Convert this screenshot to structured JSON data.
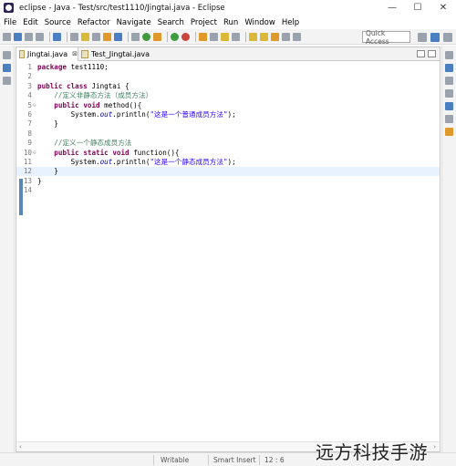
{
  "window": {
    "title": "eclipse - Java - Test/src/test1110/Jingtai.java - Eclipse",
    "controls": {
      "minimize": "—",
      "maximize": "☐",
      "close": "✕"
    }
  },
  "menu": [
    "File",
    "Edit",
    "Source",
    "Refactor",
    "Navigate",
    "Search",
    "Project",
    "Run",
    "Window",
    "Help"
  ],
  "toolbar": {
    "quick_access_placeholder": "Quick Access"
  },
  "tabs": [
    {
      "label": "Jingtai.java",
      "close": "⊠",
      "active": true
    },
    {
      "label": "Test_Jingtai.java",
      "active": false
    }
  ],
  "code": {
    "lines": [
      {
        "num": "1",
        "fold": "",
        "tokens": [
          [
            "kw",
            "package"
          ],
          [
            "",
            " test1110;"
          ]
        ]
      },
      {
        "num": "2",
        "fold": "",
        "tokens": []
      },
      {
        "num": "3",
        "fold": "",
        "tokens": [
          [
            "kw",
            "public"
          ],
          [
            "",
            " "
          ],
          [
            "kw",
            "class"
          ],
          [
            "",
            " Jingtai {"
          ]
        ]
      },
      {
        "num": "4",
        "fold": "",
        "tokens": [
          [
            "",
            "    "
          ],
          [
            "cm",
            "//定义非静态方法（成员方法）"
          ]
        ]
      },
      {
        "num": "5",
        "fold": "⊖",
        "tokens": [
          [
            "",
            "    "
          ],
          [
            "kw",
            "public"
          ],
          [
            "",
            " "
          ],
          [
            "kw",
            "void"
          ],
          [
            "",
            " method(){"
          ]
        ]
      },
      {
        "num": "6",
        "fold": "",
        "tokens": [
          [
            "",
            "        System."
          ],
          [
            "fld",
            "out"
          ],
          [
            "",
            ".println("
          ],
          [
            "str",
            "\"这是一个普通成员方法\""
          ],
          [
            "",
            ");"
          ]
        ]
      },
      {
        "num": "7",
        "fold": "",
        "tokens": [
          [
            "",
            "    }"
          ]
        ]
      },
      {
        "num": "8",
        "fold": "",
        "tokens": []
      },
      {
        "num": "9",
        "fold": "",
        "tokens": [
          [
            "",
            "    "
          ],
          [
            "cm",
            "//定义一个静态成员方法"
          ]
        ]
      },
      {
        "num": "10",
        "fold": "⊖",
        "tokens": [
          [
            "",
            "    "
          ],
          [
            "kw",
            "public"
          ],
          [
            "",
            " "
          ],
          [
            "kw",
            "static"
          ],
          [
            "",
            " "
          ],
          [
            "kw",
            "void"
          ],
          [
            "",
            " function(){"
          ]
        ]
      },
      {
        "num": "11",
        "fold": "",
        "tokens": [
          [
            "",
            "        System."
          ],
          [
            "fld",
            "out"
          ],
          [
            "",
            ".println("
          ],
          [
            "str",
            "\"这是一个静态成员方法\""
          ],
          [
            "",
            ");"
          ]
        ]
      },
      {
        "num": "12",
        "fold": "",
        "tokens": [
          [
            "",
            "    }"
          ]
        ],
        "current": true
      },
      {
        "num": "13",
        "fold": "",
        "tokens": [
          [
            "",
            "}"
          ]
        ]
      },
      {
        "num": "14",
        "fold": "",
        "tokens": []
      }
    ]
  },
  "status": {
    "writable": "Writable",
    "insert_mode": "Smart Insert",
    "position": "12 : 6"
  },
  "watermark": "远方科技手游",
  "colors": {
    "keyword": "#7f0055",
    "comment": "#3f7f5f",
    "string": "#2a00ff",
    "field": "#0000c0",
    "current_line": "#e8f2fe"
  }
}
